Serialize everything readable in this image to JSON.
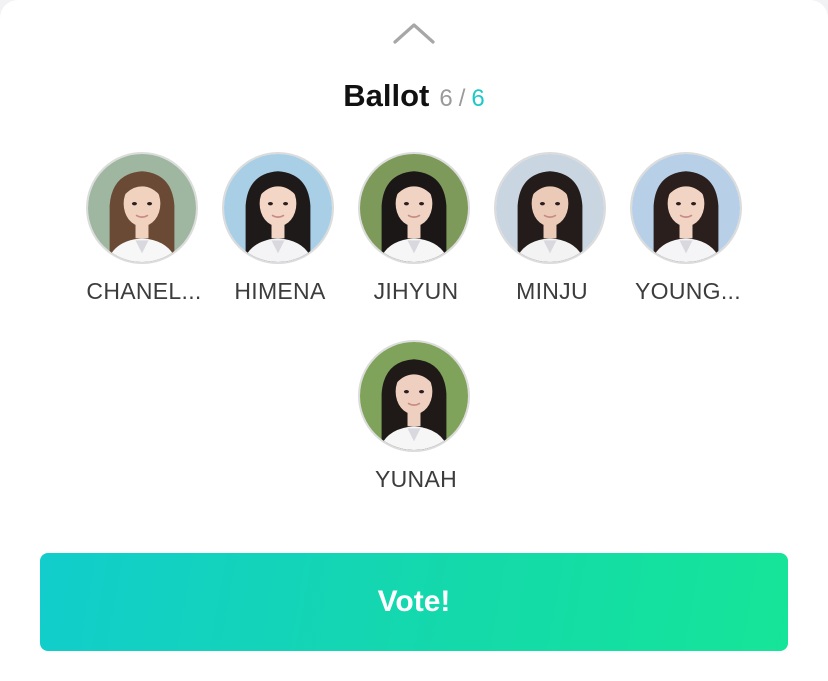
{
  "ballot": {
    "title": "Ballot",
    "selected_count": "6",
    "separator": "/",
    "total_count": "6"
  },
  "members": [
    {
      "name": "CHANEL...",
      "bg": "#9fb7a0",
      "hair": "#6b4a35",
      "skin": "#f1d2bf",
      "shirt": "#f7f7f7"
    },
    {
      "name": "HIMENA",
      "bg": "#a9cfe6",
      "hair": "#1e1a1a",
      "skin": "#f3d6c6",
      "shirt": "#f4f4f6"
    },
    {
      "name": "JIHYUN",
      "bg": "#7d9a5a",
      "hair": "#1c1717",
      "skin": "#f0d3c3",
      "shirt": "#f6f6f6"
    },
    {
      "name": "MINJU",
      "bg": "#c9d6e2",
      "hair": "#231c1a",
      "skin": "#eccab8",
      "shirt": "#f3f3f3"
    },
    {
      "name": "YOUNG...",
      "bg": "#b7d0e8",
      "hair": "#2a1f1c",
      "skin": "#f2d4c4",
      "shirt": "#f5f5f7"
    },
    {
      "name": "YUNAH",
      "bg": "#7fa35a",
      "hair": "#1f1a18",
      "skin": "#efd0c0",
      "shirt": "#f6f6f6"
    }
  ],
  "vote_button": {
    "label": "Vote!"
  },
  "icons": {
    "collapse": "chevron-up-icon"
  },
  "colors": {
    "accent": "#1ec8c8",
    "button_start": "#12cdcc",
    "button_end": "#15e598",
    "count_muted": "#9a9a9a"
  }
}
